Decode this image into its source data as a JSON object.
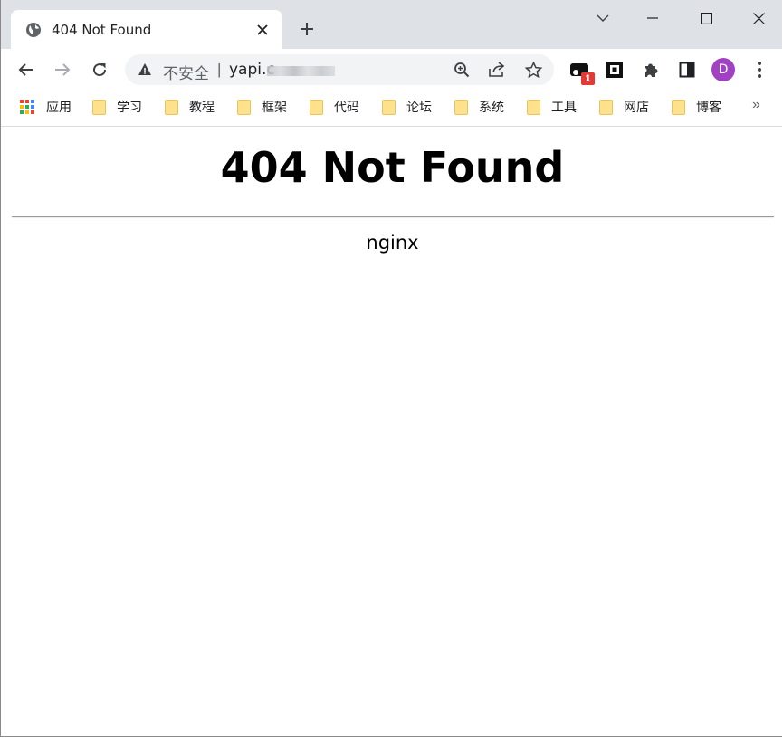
{
  "tab": {
    "title": "404 Not Found",
    "favicon": "globe-icon"
  },
  "window_controls": [
    "chevron-down-icon",
    "minimize-icon",
    "maximize-icon",
    "close-icon"
  ],
  "omnibox": {
    "security_label": "不安全",
    "separator": "|",
    "url": "yapi.c"
  },
  "profile": {
    "initial": "D",
    "color": "#a142c4"
  },
  "extension_badge": "1",
  "bookmarks": {
    "apps_label": "应用",
    "folders": [
      "学习",
      "教程",
      "框架",
      "代码",
      "论坛",
      "系统",
      "工具",
      "网店",
      "博客"
    ],
    "more": "»"
  },
  "page": {
    "heading": "404 Not Found",
    "server": "nginx"
  }
}
